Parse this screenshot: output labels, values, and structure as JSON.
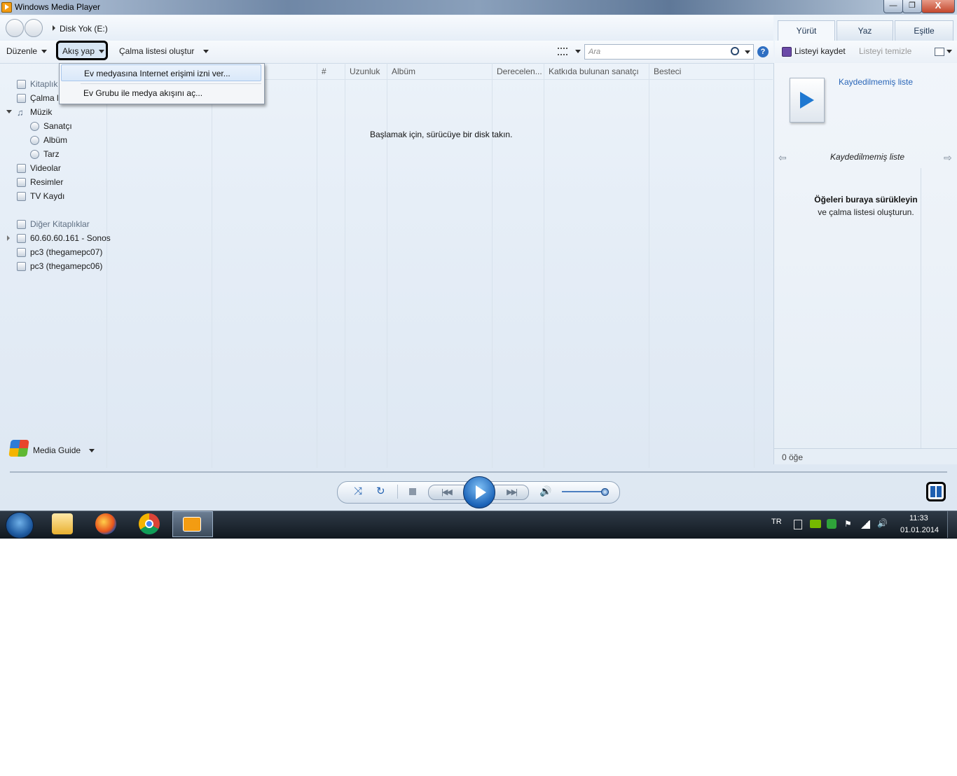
{
  "window": {
    "title": "Windows Media Player",
    "minimize": "—",
    "maximize": "❐",
    "close": "X"
  },
  "nav": {
    "breadcrumb": "Disk Yok (E:)"
  },
  "tabs": [
    "Yürüt",
    "Yaz",
    "Eşitle"
  ],
  "toolbar": {
    "organize": "Düzenle",
    "stream": "Akış yap",
    "create_playlist": "Çalma listesi oluştur",
    "search_placeholder": "Ara",
    "help": "?"
  },
  "stream_menu": {
    "items": [
      "Ev medyasına Internet erişimi izni ver...",
      "Ev Grubu ile medya akışını aç..."
    ]
  },
  "library": {
    "items": [
      {
        "label": "Kitaplık",
        "icon": "library-icon"
      },
      {
        "label": "Çalma l",
        "icon": "playlist-icon"
      },
      {
        "label": "Müzik",
        "icon": "music-icon"
      },
      {
        "label": "Sanatçı",
        "icon": "artist-icon"
      },
      {
        "label": "Albüm",
        "icon": "album-icon"
      },
      {
        "label": "Tarz",
        "icon": "genre-icon"
      },
      {
        "label": "Videolar",
        "icon": "video-icon"
      },
      {
        "label": "Resimler",
        "icon": "pictures-icon"
      },
      {
        "label": "TV Kaydı",
        "icon": "tv-icon"
      },
      {
        "label": "Diğer Kitaplıklar",
        "icon": "other-libraries-icon"
      },
      {
        "label": "60.60.60.161 - Sonos",
        "icon": "network-library-icon"
      },
      {
        "label": "pc3 (thegamepc07)",
        "icon": "network-library-icon"
      },
      {
        "label": "pc3 (thegamepc06)",
        "icon": "network-library-icon"
      }
    ],
    "media_guide": "Media Guide"
  },
  "columns": [
    "#",
    "Uzunluk",
    "Albüm",
    "Derecelen...",
    "Katkıda bulunan sanatçı",
    "Besteci"
  ],
  "main": {
    "empty_message": "Başlamak için, sürücüye bir disk takın."
  },
  "list_pane": {
    "save_list": "Listeyi kaydet",
    "clear_list": "Listeyi temizle",
    "unsaved_list_link": "Kaydedilmemiş liste",
    "list_title": "Kaydedilmemiş liste",
    "drag_here": "Öğeleri buraya sürükleyin",
    "drag_here_sub": "ve çalma listesi oluşturun.",
    "item_count": "0 öğe"
  },
  "taskbar": {
    "language": "TR",
    "time": "11:33",
    "date": "01.01.2014"
  },
  "colors": {
    "accent": "#1b63b8",
    "link": "#2a66b8",
    "highlight_border": "#000000"
  }
}
